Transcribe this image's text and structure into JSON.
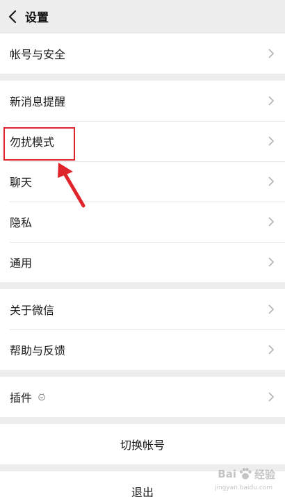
{
  "header": {
    "back_icon": "chevron-left-icon",
    "title": "设置"
  },
  "groups": [
    {
      "items": [
        {
          "label": "帐号与安全"
        }
      ]
    },
    {
      "items": [
        {
          "label": "新消息提醒"
        },
        {
          "label": "勿扰模式"
        },
        {
          "label": "聊天"
        },
        {
          "label": "隐私"
        },
        {
          "label": "通用"
        }
      ]
    },
    {
      "items": [
        {
          "label": "关于微信"
        },
        {
          "label": "帮助与反馈"
        }
      ]
    },
    {
      "items": [
        {
          "label": "插件",
          "icon": "plugin-badge-icon"
        }
      ]
    }
  ],
  "actions": {
    "switch_account": "切换帐号",
    "logout": "退出"
  },
  "annotation": {
    "highlight_color": "#e0242c",
    "highlighted_item": "勿扰模式"
  },
  "watermark": {
    "brand_left": "Bai",
    "brand_right": "经验",
    "sub": "jingyan.baidu.com"
  },
  "colors": {
    "background": "#ededed",
    "surface": "#ffffff",
    "chevron": "#b2b2b2"
  }
}
